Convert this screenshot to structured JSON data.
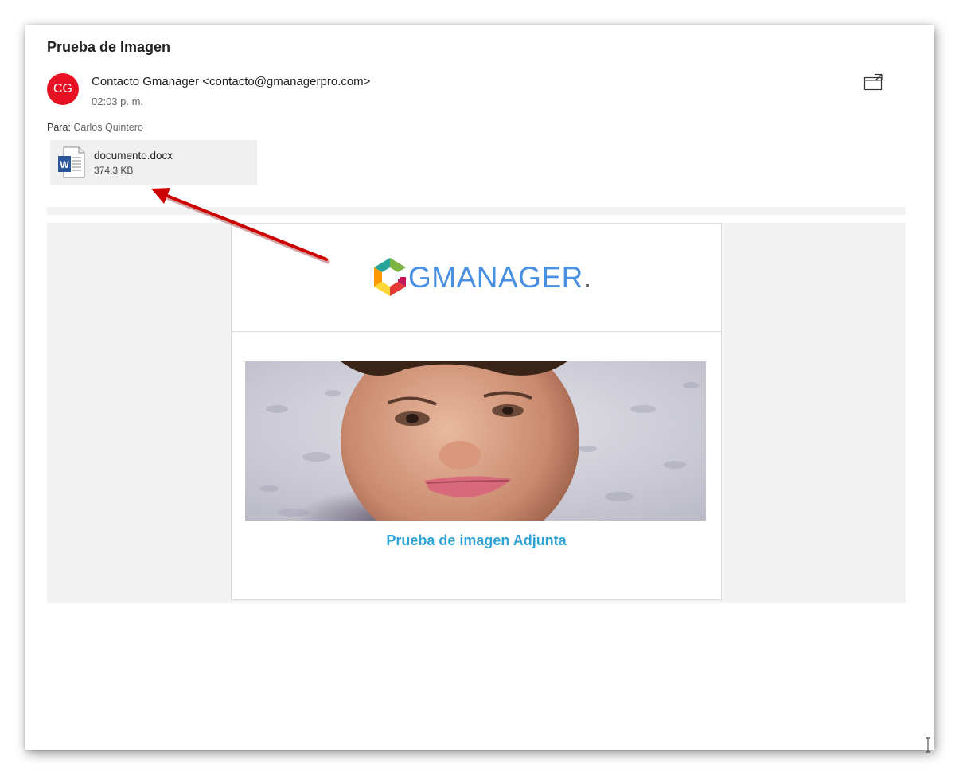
{
  "email": {
    "subject": "Prueba de Imagen",
    "avatar_initials": "CG",
    "avatar_color": "#e81123",
    "sender": "Contacto Gmanager <contacto@gmanagerpro.com>",
    "time": "02:03 p. m.",
    "to_label": "Para:",
    "to_name": "Carlos Quintero",
    "popout_icon": "popout-window-icon"
  },
  "attachment": {
    "icon": "word-document-icon",
    "name": "documento.docx",
    "size": "374.3 KB"
  },
  "body": {
    "logo_text": "GMANAGER",
    "logo_dot": ".",
    "photo": "beach-portrait-photo",
    "caption": "Prueba de imagen Adjunta"
  },
  "annotation": {
    "arrow_color": "#cc0000"
  }
}
